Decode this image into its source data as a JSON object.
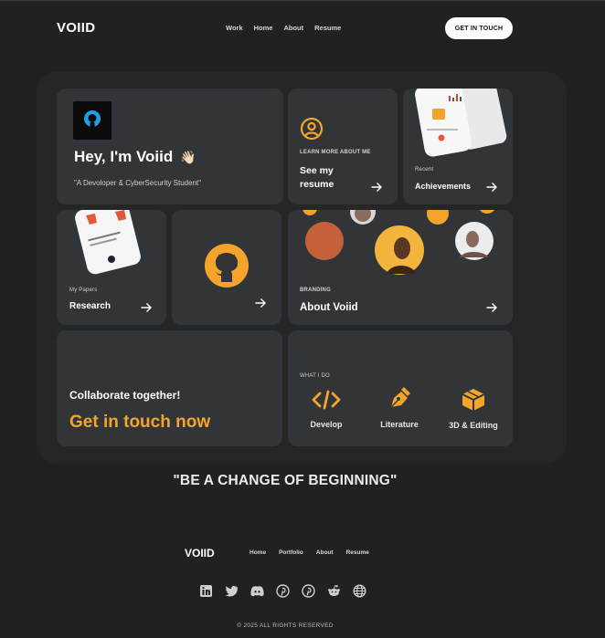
{
  "nav": {
    "logo": "VOIID",
    "links": [
      "Work",
      "Home",
      "About",
      "Resume"
    ],
    "cta": "GET IN TOUCH"
  },
  "hero": {
    "title": "Hey, I'm Voiid",
    "emoji": "👋🏻",
    "subtitle": "\"A Devoloper & CyberSecurity Student\""
  },
  "resume_card": {
    "label": "LEARN MORE ABOUT ME",
    "title_line1": "See my",
    "title_line2": "resume"
  },
  "achievements_card": {
    "label": "Recent",
    "title": "Achievements"
  },
  "research_card": {
    "label": "My Papers",
    "title": "Research"
  },
  "about_card": {
    "label": "BRANDING",
    "title": "About Voiid"
  },
  "collab_card": {
    "title": "Collaborate together!",
    "cta": "Get in touch now"
  },
  "whatido": {
    "label": "WHAT I DO",
    "skills": [
      "Develop",
      "Literature",
      "3D & Editing"
    ]
  },
  "quote": "\"BE A CHANGE OF BEGINNING\"",
  "footer": {
    "logo": "VOIID",
    "links": [
      "Home",
      "Portfolio",
      "About",
      "Resume"
    ],
    "socials": [
      "linkedin-icon",
      "twitter-icon",
      "discord-icon",
      "pinterest-icon",
      "pinterest-icon",
      "reddit-icon",
      "globe-icon"
    ],
    "copyright": "© 2025 ALL RIGHTS RESERVED"
  },
  "colors": {
    "background": "#212121",
    "card": "#323537",
    "accent": "#f4a42a"
  }
}
